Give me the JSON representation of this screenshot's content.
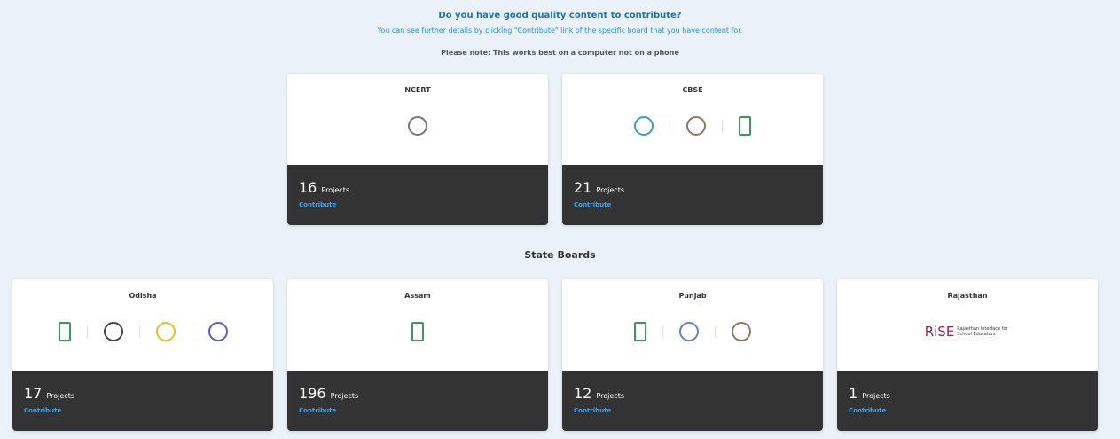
{
  "header": {
    "question": "Do you have good quality content to contribute?",
    "subtitle": "You can see further details by clicking \"Contribute\" link of the specific board that you have content for.",
    "note": "Please note: This works best on a computer not on a phone"
  },
  "section_title": "State Boards",
  "projects_label": "Projects",
  "contribute_label": "Contribute",
  "rise_logo": {
    "mark": "RiSE",
    "text": "Rajasthan Interface for School Educators"
  },
  "boards": [
    {
      "name": "NCERT",
      "count": "16",
      "logos": [
        "ncert-logo"
      ]
    },
    {
      "name": "CBSE",
      "count": "21",
      "logos": [
        "cbse-logo",
        "emblem-logo",
        "diksha-logo"
      ]
    },
    {
      "name": "Odisha",
      "count": "17",
      "logos": [
        "diksha-logo",
        "board-logo",
        "state-logo",
        "odisha-emblem-logo"
      ]
    },
    {
      "name": "Assam",
      "count": "196",
      "logos": [
        "diksha-logo"
      ]
    },
    {
      "name": "Punjab",
      "count": "12",
      "logos": [
        "diksha-logo",
        "pseb-logo",
        "emblem-logo"
      ]
    },
    {
      "name": "Rajasthan",
      "count": "1",
      "logos": [
        "rise-logo"
      ]
    }
  ],
  "colors": {
    "accent": "#1a73b8",
    "link": "#3fa3ee",
    "card_footer": "#333333"
  }
}
